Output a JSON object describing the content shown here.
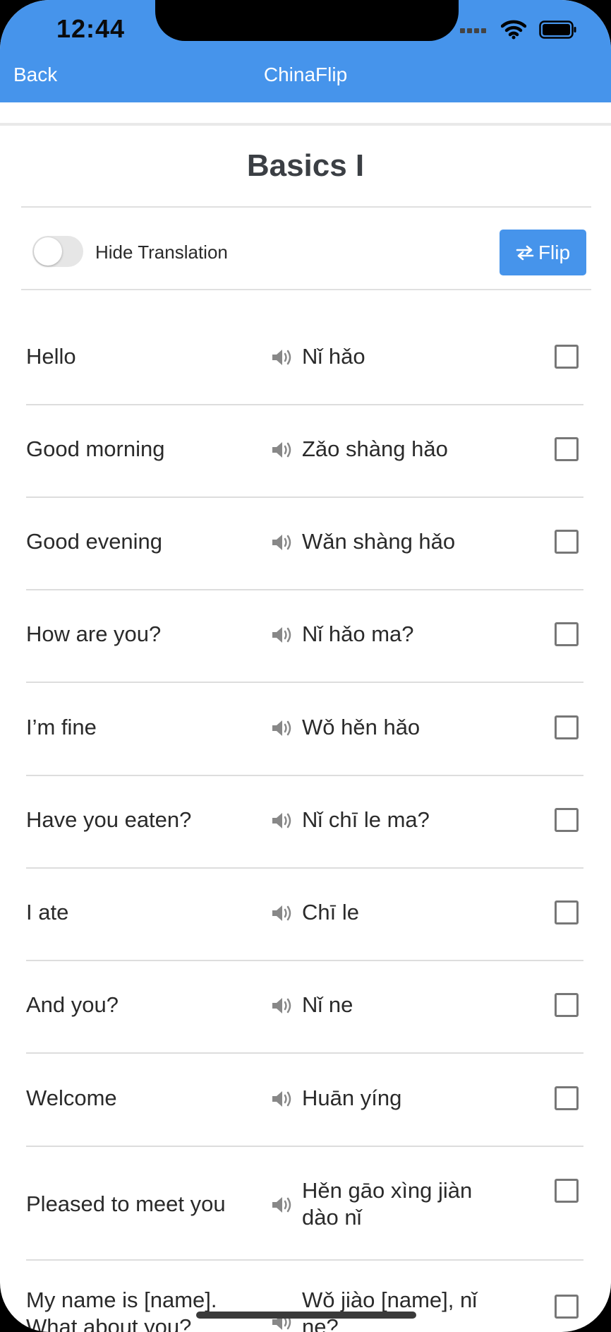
{
  "status_bar": {
    "time": "12:44"
  },
  "nav": {
    "back_label": "Back",
    "title": "ChinaFlip"
  },
  "page": {
    "title": "Basics I"
  },
  "controls": {
    "toggle_label": "Hide Translation",
    "flip_label": "Flip"
  },
  "colors": {
    "accent": "#4694EB",
    "text": "#2a2a2a",
    "title": "#3b3f44"
  },
  "phrases": [
    {
      "english": "Hello",
      "pinyin": "Nǐ hǎo"
    },
    {
      "english": "Good morning",
      "pinyin": "Zǎo shàng hǎo"
    },
    {
      "english": "Good evening",
      "pinyin": "Wǎn shàng hǎo"
    },
    {
      "english": "How are you?",
      "pinyin": "Nǐ hǎo ma?"
    },
    {
      "english": "I’m fine",
      "pinyin": "Wǒ hěn hǎo"
    },
    {
      "english": "Have you eaten?",
      "pinyin": "Nǐ chī le ma?"
    },
    {
      "english": "I ate",
      "pinyin": "Chī le"
    },
    {
      "english": "And you?",
      "pinyin": "Nǐ ne"
    },
    {
      "english": "Welcome",
      "pinyin": "Huān yíng"
    },
    {
      "english": "Pleased to meet you",
      "pinyin": "Hěn gāo xìng jiàn dào nǐ"
    },
    {
      "english": "My name is [name]. What about you?",
      "pinyin": "Wǒ jiào [name], nǐ ne?"
    }
  ]
}
